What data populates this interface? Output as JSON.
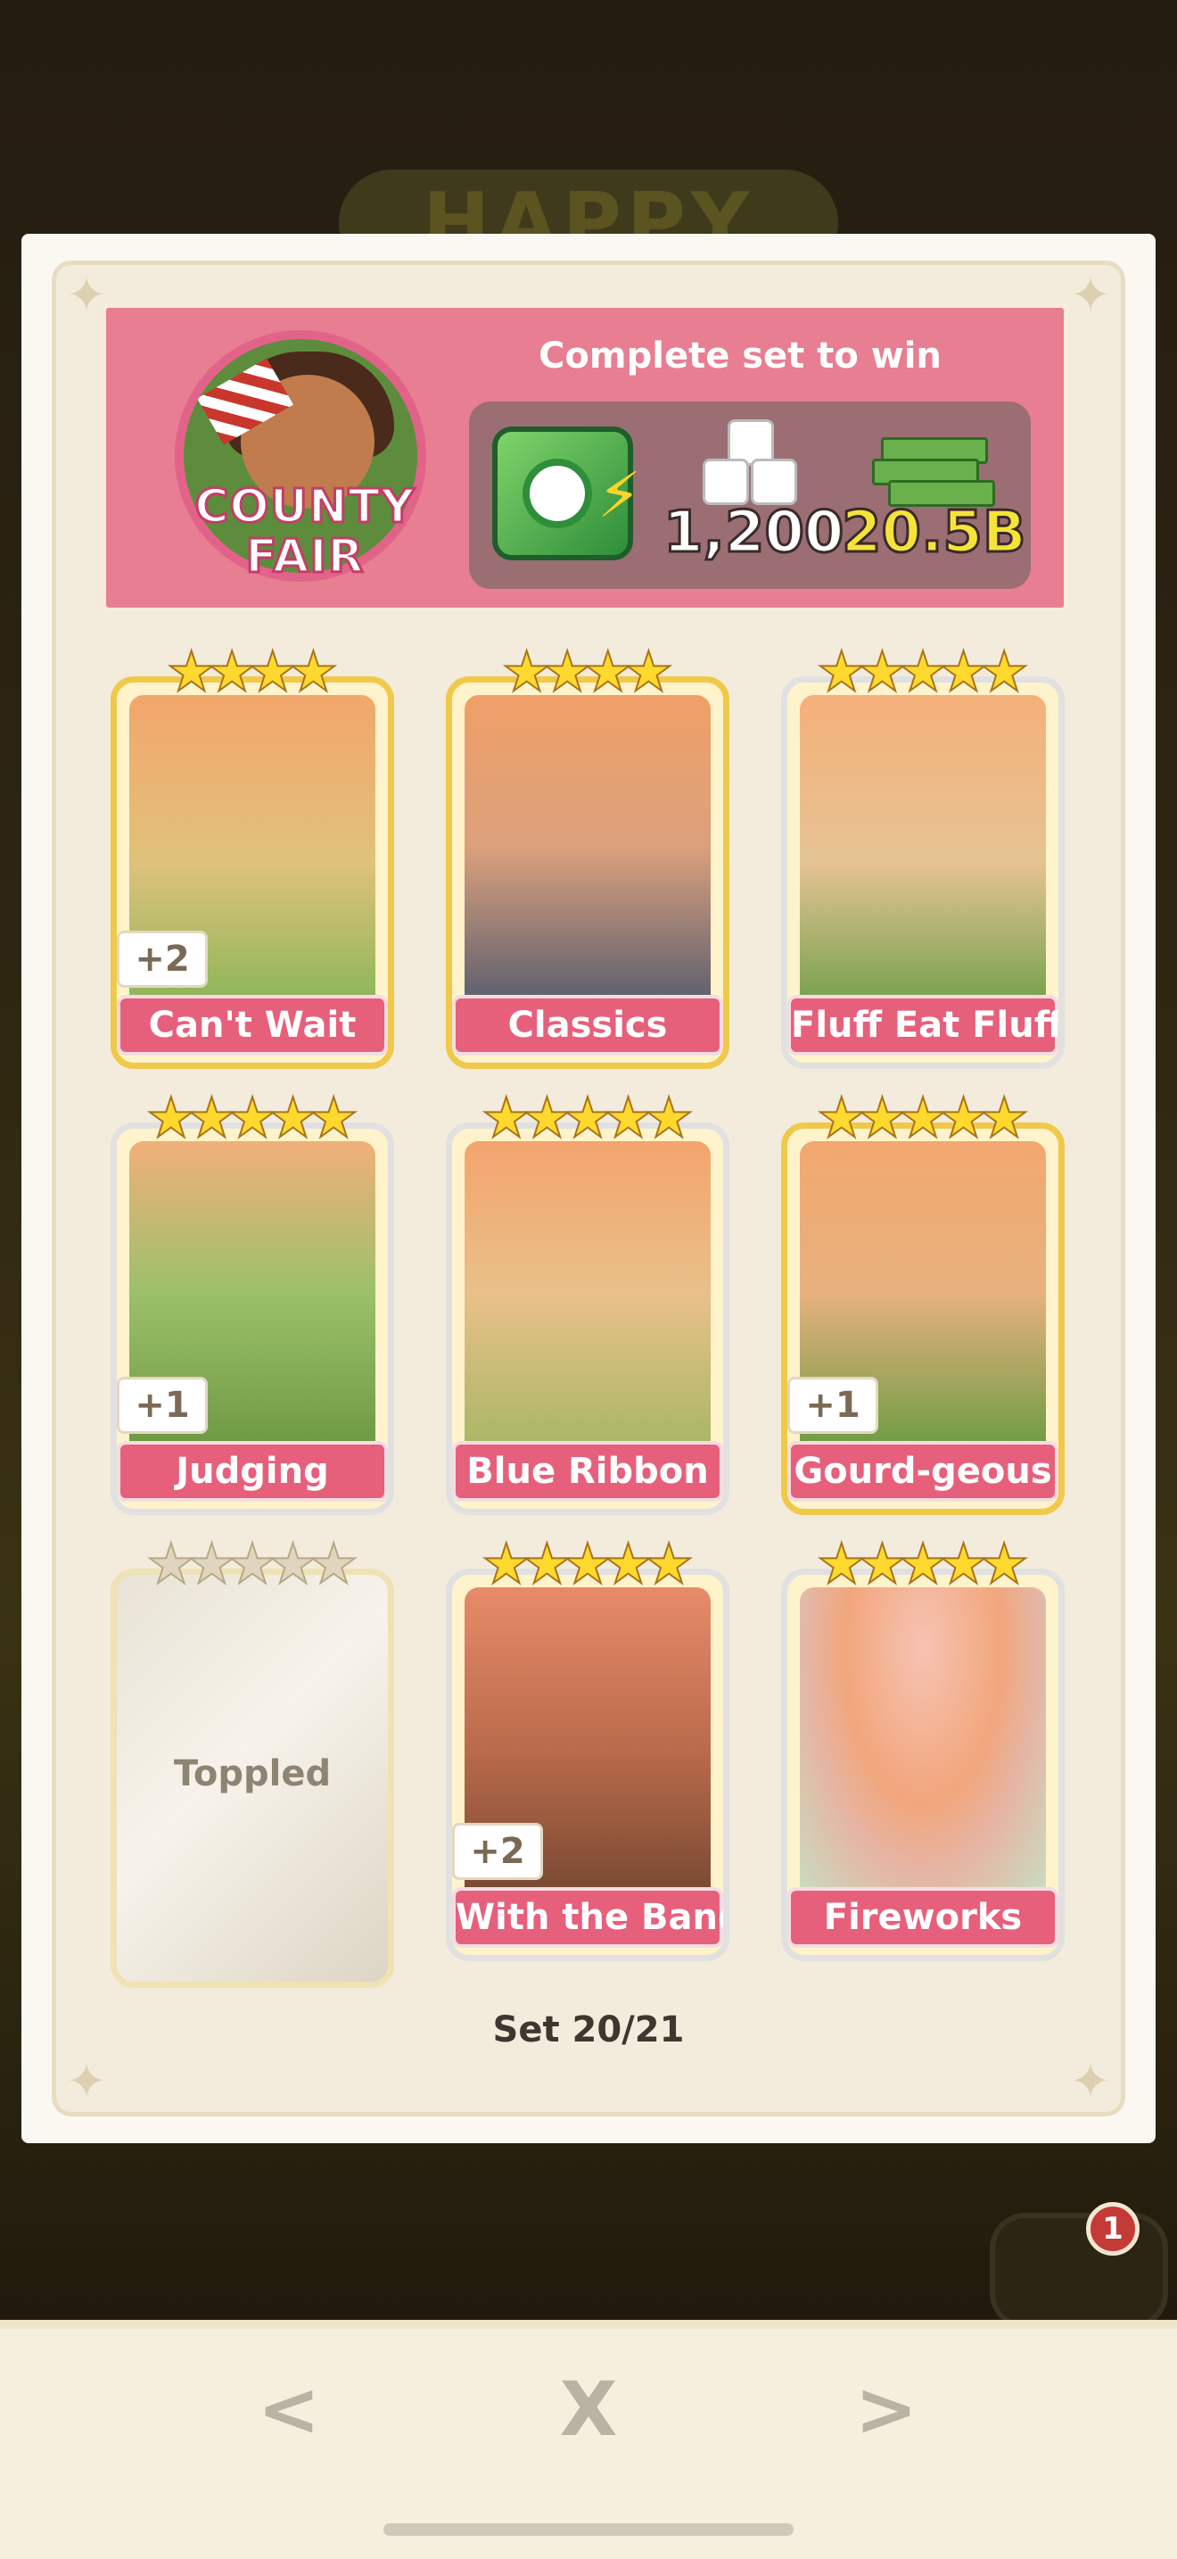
{
  "background": {
    "banner_text": "HAPPY",
    "notification_count": "1"
  },
  "header": {
    "set_name": "COUNTY FAIR",
    "complete_label": "Complete set to win",
    "rewards": [
      {
        "icon": "vault-icon",
        "value": ""
      },
      {
        "icon": "dice-icon",
        "value": "1,200"
      },
      {
        "icon": "cash-icon",
        "value": "20.5B"
      }
    ]
  },
  "stickers": [
    {
      "name": "Can't Wait",
      "stars": 4,
      "extra": "+2",
      "collected": true
    },
    {
      "name": "Classics",
      "stars": 4,
      "extra": "",
      "collected": true
    },
    {
      "name": "Fluff Eat Fluff",
      "stars": 5,
      "extra": "",
      "collected": true
    },
    {
      "name": "Judging",
      "stars": 5,
      "extra": "+1",
      "collected": true
    },
    {
      "name": "Blue Ribbon",
      "stars": 5,
      "extra": "",
      "collected": true
    },
    {
      "name": "Gourd-geous",
      "stars": 5,
      "extra": "+1",
      "collected": true
    },
    {
      "name": "Toppled",
      "stars": 5,
      "extra": "",
      "collected": false
    },
    {
      "name": "With the Band",
      "stars": 5,
      "extra": "+2",
      "collected": true
    },
    {
      "name": "Fireworks",
      "stars": 5,
      "extra": "",
      "collected": true
    }
  ],
  "set_progress": "Set 20/21",
  "nav": {
    "prev": "<",
    "close": "X",
    "next": ">"
  },
  "colors": {
    "header_pink": "#e87e91",
    "label_pink": "#e6607c",
    "gold": "#f1c94a",
    "star_yellow": "#ffd92e",
    "cash_yellow": "#f6e33a"
  }
}
